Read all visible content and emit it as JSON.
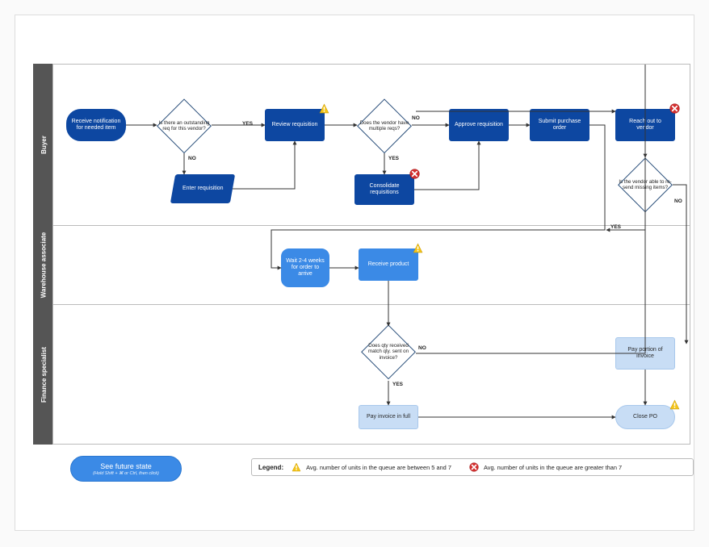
{
  "lanes": {
    "buyer": "Buyer",
    "warehouse": "Warehouse associate",
    "finance": "Finance specialist"
  },
  "nodes": {
    "receive_notif": "Receive notification for needed item",
    "outstanding_req": "Is there an outstanding req for this vendor?",
    "enter_req": "Enter requisition",
    "review_req": "Review requisition",
    "multi_reqs": "Does the vendor have multiple reqs?",
    "consolidate": "Consolidate requisitions",
    "approve_req": "Approve requisition",
    "submit_po": "Submit purchase order",
    "reach_vendor": "Reach out to vendor",
    "vendor_resend": "Is the vendor able to re-send missing items?",
    "wait_order": "Wait 2-4 weeks for order to arrive",
    "receive_product": "Receive product",
    "qty_match": "Does qty received match qty. sent on invoice?",
    "pay_full": "Pay invoice in full",
    "pay_portion": "Pay portion of invoice",
    "close_po": "Close PO"
  },
  "edge_labels": {
    "yes": "YES",
    "no": "NO"
  },
  "future": {
    "title": "See future state",
    "sub": "(Hold Shift + ⌘ or Ctrl, then click)"
  },
  "legend": {
    "title": "Legend:",
    "warn_text": "Avg. number of units in the queue are between 5 and  7",
    "err_text": "Avg. number of units in the queue are greater than 7"
  }
}
